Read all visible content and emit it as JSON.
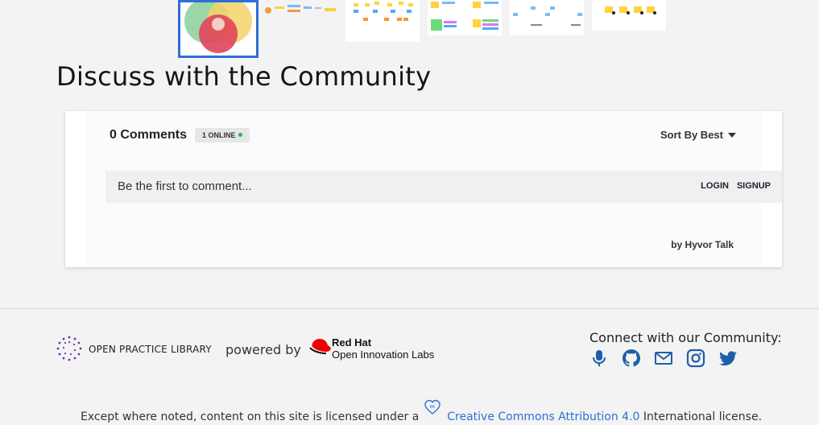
{
  "page": {
    "title": "Discuss with the Community"
  },
  "comments": {
    "count_label": "0 Comments",
    "online_label": "1 ONLINE",
    "sort_label": "Sort By Best",
    "placeholder": "Be the first to comment...",
    "login_label": "LOGIN",
    "signup_label": "SIGNUP",
    "powered_by": "by Hyvor Talk"
  },
  "footer": {
    "opl_label": "OPEN PRACTICE LIBRARY",
    "powered_label": "powered by",
    "redhat_name": "Red Hat",
    "redhat_sub": "Open Innovation Labs",
    "connect_label": "Connect with our Community:",
    "social_icons": [
      "microphone-icon",
      "github-icon",
      "mail-icon",
      "instagram-icon",
      "twitter-icon"
    ],
    "license_prefix": "Except where noted, content on this site is licensed under a",
    "license_link": "Creative Commons Attribution 4.0",
    "license_suffix": "International license."
  },
  "colors": {
    "accent": "#2e6fd6",
    "online_dot": "#2bb34a",
    "redhat_red": "#ee0000"
  }
}
